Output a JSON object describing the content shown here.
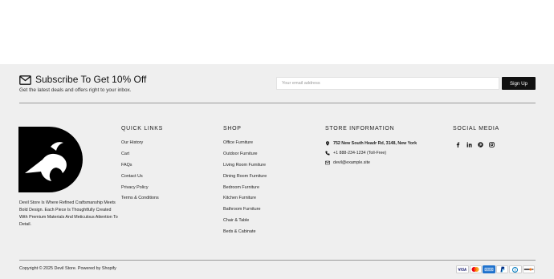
{
  "subscribe": {
    "title": "Subscribe To Get 10% Off",
    "subtitle": "Get the latest deals and offers right to your inbox.",
    "email_placeholder": "Your email address",
    "button_label": "Sign Up",
    "icon": "envelope-icon"
  },
  "brand": {
    "logo": "devil-store-logo",
    "description": "Devil Store Is Where Refined Craftsmanship Meets Bold Design. Each Piece Is Thoughtfully Created With Premium Materials And Meticulous Attention To Detail."
  },
  "quick_links": {
    "title": "QUICK LINKS",
    "items": [
      "Our History",
      "Cart",
      "FAQs",
      "Contact Us",
      "Privacy Policy",
      "Terms & Conditions"
    ]
  },
  "shop": {
    "title": "SHOP",
    "items": [
      "Office Furniture",
      "Outdoor Furniture",
      "Living Room Furniture",
      "Dining Room Furniture",
      "Bedroom Furniture",
      "Kitchen Furniture",
      "Bathroom Furniture",
      "Chair & Table",
      "Beds & Cabinate"
    ]
  },
  "store_info": {
    "title": "STORE INFORMATION",
    "address": "752 New South Headr Rd, 3148, New York",
    "phone": "+1 888-234-1234 (Toll-Free)",
    "email": "devil@example.site"
  },
  "social": {
    "title": "SOCIAL MEDIA",
    "icons": [
      "facebook-icon",
      "linkedin-icon",
      "pinterest-icon",
      "instagram-icon"
    ]
  },
  "footer_bottom": {
    "copyright": "Copyright © 2025 Devil Store. Powered by Shopify",
    "payment_icons": [
      "visa-icon",
      "mastercard-icon",
      "amex-icon",
      "paypal-icon",
      "diners-club-icon",
      "discover-icon"
    ]
  },
  "colors": {
    "footer_bg": "#efefef",
    "button_bg": "#111111",
    "text": "#1a1a1a"
  }
}
